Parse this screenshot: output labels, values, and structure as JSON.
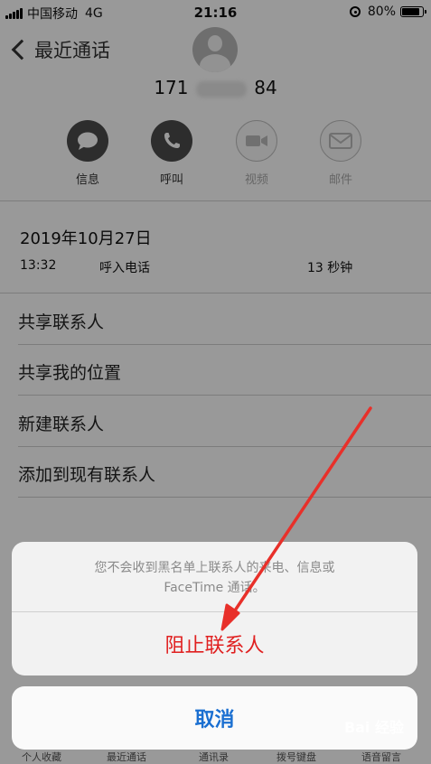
{
  "status_bar": {
    "carrier": "中国移动",
    "network": "4G",
    "time": "21:16",
    "battery": "80%",
    "battery_level": 0.8
  },
  "nav": {
    "back_label": "最近通话"
  },
  "contact": {
    "number_prefix": "171",
    "number_suffix": "84"
  },
  "actions": [
    {
      "label": "信息",
      "icon": "message-icon",
      "enabled": true
    },
    {
      "label": "呼叫",
      "icon": "phone-icon",
      "enabled": true
    },
    {
      "label": "视频",
      "icon": "video-icon",
      "enabled": false
    },
    {
      "label": "邮件",
      "icon": "mail-icon",
      "enabled": false
    }
  ],
  "call_history": {
    "date": "2019年10月27日",
    "time": "13:32",
    "type": "呼入电话",
    "duration": "13 秒钟"
  },
  "menu": [
    "共享联系人",
    "共享我的位置",
    "新建联系人",
    "添加到现有联系人"
  ],
  "action_sheet": {
    "message_line1": "您不会收到黑名单上联系人的来电、信息或",
    "message_line2": "FaceTime 通话。",
    "block_label": "阻止联系人",
    "cancel_label": "取消"
  },
  "tab_bar": [
    "个人收藏",
    "最近通话",
    "通讯录",
    "拨号键盘",
    "语音留言"
  ],
  "watermark": "Bai 经验",
  "colors": {
    "destructive": "#e02020",
    "accent": "#1a6fd1",
    "annotation": "#e8302a"
  }
}
